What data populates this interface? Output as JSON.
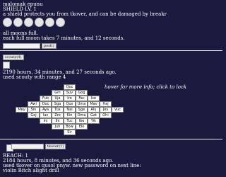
{
  "player1": {
    "name": "malomak epunu",
    "shield": "SHIELD LV. 1",
    "shield_desc": "a shield protects you from tkover, and can be damaged by breakr",
    "moons_count_visible": 6,
    "moons_status": "all moons full.",
    "moons_timer": "each full moon takes 7 minutes, and 12 seconds.",
    "button": "post()"
  },
  "player2": {
    "button": "scouty(4)",
    "time": "2190 hours, 34 minutes, and 27 seconds ago.",
    "action": "used scouty with range 4",
    "hint": "hover for more info; click to lock",
    "grid": [
      [
        "Qoc"
      ],
      [
        "Gih",
        "Suv",
        "Gog"
      ],
      [
        "Fub",
        "Uja",
        "Iro",
        "Fac",
        "Ise"
      ],
      [
        "Awi",
        "Ooc",
        "Sga",
        "Qux",
        "Uma",
        "Mav",
        "Haj"
      ],
      [
        "Mey",
        "Sin",
        "Aya",
        "Tux",
        "Nai",
        "Sge",
        "Alu",
        "Jes",
        "Vuc"
      ],
      [
        "Goj",
        "Iac",
        "Zro",
        "Kin",
        "Oma",
        "Gat",
        "Ohi"
      ],
      [
        "Ini",
        "Ihi",
        "Tuc",
        "Ibe",
        "Yik"
      ],
      [
        "Juh",
        "Bow",
        "Eki"
      ],
      [
        "Sir"
      ]
    ]
  },
  "player3": {
    "button": "tkover(1)",
    "reach": "REACH: 1",
    "time": "2184 hours, 8 minutes, and 36 seconds ago.",
    "action": "used tkover on qusol pnyw. new password on next line:",
    "password": "violin Bitch alight drill"
  }
}
